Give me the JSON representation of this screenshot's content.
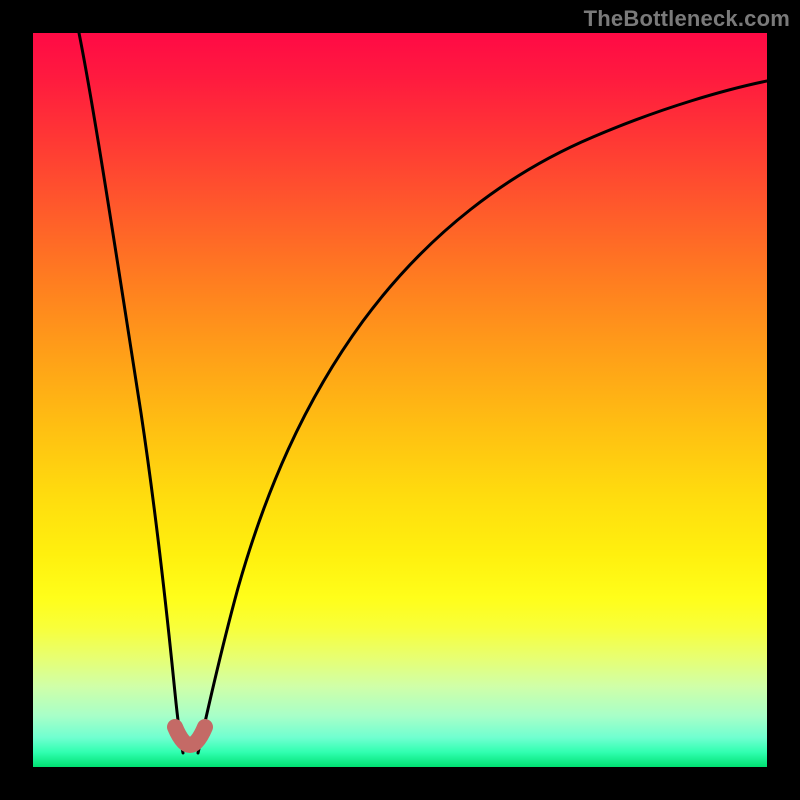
{
  "watermark": "TheBottleneck.com",
  "chart_data": {
    "type": "line",
    "title": "",
    "xlabel": "",
    "ylabel": "",
    "xlim": [
      0,
      100
    ],
    "ylim": [
      0,
      100
    ],
    "grid": false,
    "legend": false,
    "series": [
      {
        "name": "bottleneck-curve",
        "x": [
          0,
          4,
          8,
          12,
          15,
          17,
          18.5,
          20,
          21.5,
          23,
          26,
          30,
          35,
          42,
          52,
          64,
          78,
          92,
          100
        ],
        "values": [
          100,
          80,
          60,
          41,
          25,
          14,
          7,
          2,
          7,
          14,
          27,
          42,
          55,
          67,
          77,
          84,
          89,
          92,
          93
        ]
      }
    ],
    "annotations": [
      {
        "name": "dip-highlight",
        "x_range": [
          18,
          22
        ],
        "y": 3,
        "color": "#c46a66"
      }
    ],
    "colors": {
      "curve": "#000000",
      "gradient_top": "#ff0a45",
      "gradient_bottom": "#00e072",
      "highlight": "#c46a66",
      "frame": "#000000"
    }
  }
}
